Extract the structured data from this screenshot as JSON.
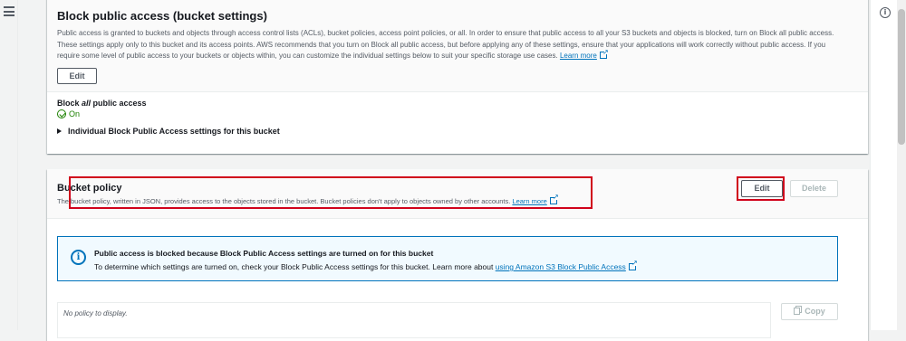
{
  "sidebar": {
    "menu_icon": "hamburger-menu-icon"
  },
  "right_rail": {
    "info_icon": "info-icon",
    "info_glyph": "i"
  },
  "block_public_access": {
    "title": "Block public access (bucket settings)",
    "description": "Public access is granted to buckets and objects through access control lists (ACLs), bucket policies, access point policies, or all. In order to ensure that public access to all your S3 buckets and objects is blocked, turn on Block all public access. These settings apply only to this bucket and its access points. AWS recommends that you turn on Block all public access, but before applying any of these settings, ensure that your applications will work correctly without public access. If you require some level of public access to your buckets or objects within, you can customize the individual settings below to suit your specific storage use cases.",
    "learn_more": "Learn more",
    "edit_label": "Edit",
    "setting_label_prefix": "Block ",
    "setting_label_emph": "all",
    "setting_label_suffix": " public access",
    "status": "On",
    "expander_label": "Individual Block Public Access settings for this bucket"
  },
  "bucket_policy": {
    "title": "Bucket policy",
    "description": "The bucket policy, written in JSON, provides access to the objects stored in the bucket. Bucket policies don't apply to objects owned by other accounts.",
    "learn_more": "Learn more",
    "edit_label": "Edit",
    "delete_label": "Delete",
    "alert_title": "Public access is blocked because Block Public Access settings are turned on for this bucket",
    "alert_text": "To determine which settings are turned on, check your Block Public Access settings for this bucket. Learn more about ",
    "alert_link": "using Amazon S3 Block Public Access",
    "empty_text": "No policy to display.",
    "copy_label": "Copy"
  },
  "colors": {
    "highlight": "#d0021b",
    "link": "#0073bb",
    "success": "#1d8102",
    "info_bg": "#f1faff"
  }
}
